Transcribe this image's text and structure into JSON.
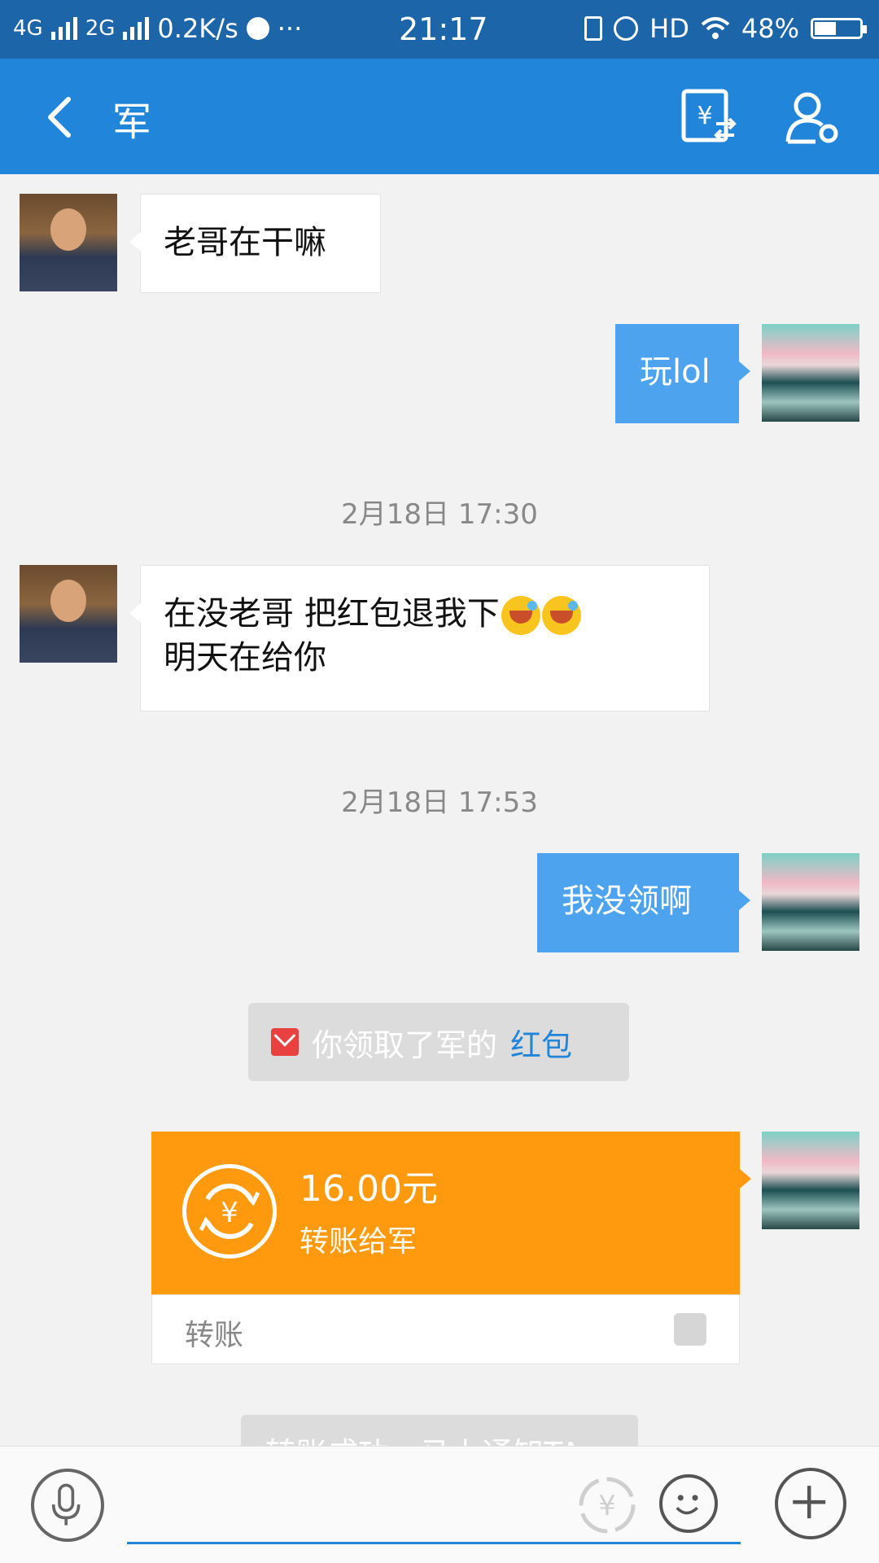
{
  "status_bar": {
    "network_1": "4G",
    "network_2": "2G",
    "speed": "0.2K/s",
    "more": "···",
    "time": "21:17",
    "hd": "HD",
    "battery": "48%",
    "battery_level": 0.48
  },
  "header": {
    "title": "军",
    "back_icon": "back-chevron-icon",
    "transfer_icon": "money-transfer-icon",
    "profile_icon": "user-settings-icon"
  },
  "messages": [
    {
      "from": "friend",
      "text": "老哥在干嘛"
    },
    {
      "from": "me",
      "text": "玩lol"
    },
    {
      "type": "timestamp",
      "text": "2月18日 17:30"
    },
    {
      "from": "friend",
      "line1": "在没老哥  把红包退我下",
      "line2": "明天在给你"
    },
    {
      "type": "timestamp",
      "text": "2月18日 17:53"
    },
    {
      "from": "me",
      "text": "我没领啊"
    }
  ],
  "system_notice": {
    "text": "你领取了军的",
    "link": "红包"
  },
  "transfer": {
    "amount": "16.00元",
    "description": "转账给军",
    "footer_label": "转账"
  },
  "system_notice_2": {
    "text": "转账成功，马上通知TA"
  },
  "colors": {
    "header": "#2185d9",
    "status_bar": "#1c65a8",
    "my_bubble": "#4da3ee",
    "transfer_card": "#ff9a0e",
    "link": "#2185d9"
  }
}
